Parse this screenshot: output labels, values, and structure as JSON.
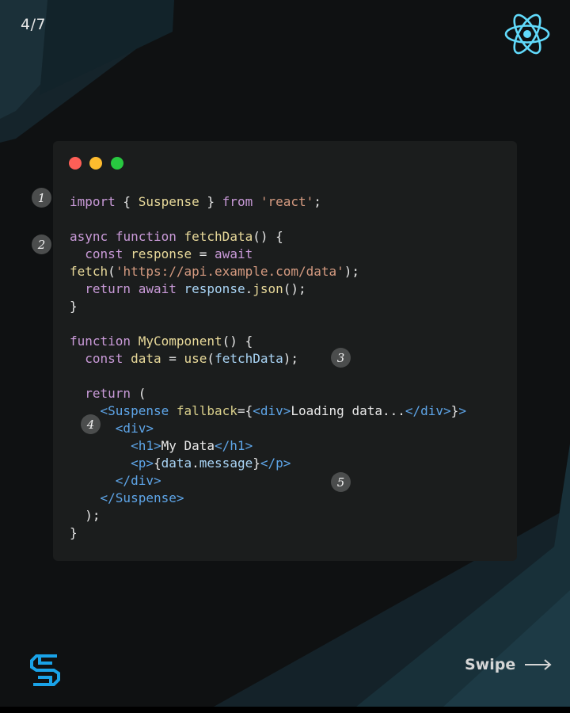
{
  "page_counter": "4/7",
  "colors": {
    "background": "#0f1112",
    "card": "#1b1d1d",
    "keyword": "#c99ad8",
    "function": "#e8d99a",
    "string": "#d49a80",
    "tag": "#5ea5e8",
    "attribute": "#d9cf8b",
    "variable": "#a9d4f5",
    "react_logo": "#61dafb",
    "brand_logo": "#1aa3e8"
  },
  "window_dots": [
    "red",
    "yellow",
    "green"
  ],
  "code_lines": [
    [
      [
        "keyword",
        "import"
      ],
      [
        "default",
        " { "
      ],
      [
        "func",
        "Suspense"
      ],
      [
        "default",
        " } "
      ],
      [
        "keyword",
        "from"
      ],
      [
        "default",
        " "
      ],
      [
        "string",
        "'react'"
      ],
      [
        "default",
        ";"
      ]
    ],
    [],
    [
      [
        "keyword",
        "async"
      ],
      [
        "default",
        " "
      ],
      [
        "keyword",
        "function"
      ],
      [
        "default",
        " "
      ],
      [
        "func",
        "fetchData"
      ],
      [
        "default",
        "() {"
      ]
    ],
    [
      [
        "default",
        "  "
      ],
      [
        "keyword",
        "const"
      ],
      [
        "default",
        " "
      ],
      [
        "func",
        "response"
      ],
      [
        "default",
        " = "
      ],
      [
        "keyword",
        "await"
      ]
    ],
    [
      [
        "func",
        "fetch"
      ],
      [
        "default",
        "("
      ],
      [
        "string",
        "'https://api.example.com/data'"
      ],
      [
        "default",
        ");"
      ]
    ],
    [
      [
        "default",
        "  "
      ],
      [
        "keyword",
        "return"
      ],
      [
        "default",
        " "
      ],
      [
        "keyword",
        "await"
      ],
      [
        "default",
        " "
      ],
      [
        "var",
        "response"
      ],
      [
        "default",
        "."
      ],
      [
        "func",
        "json"
      ],
      [
        "default",
        "();"
      ]
    ],
    [
      [
        "default",
        "}"
      ]
    ],
    [],
    [
      [
        "keyword",
        "function"
      ],
      [
        "default",
        " "
      ],
      [
        "func",
        "MyComponent"
      ],
      [
        "default",
        "() {"
      ]
    ],
    [
      [
        "default",
        "  "
      ],
      [
        "keyword",
        "const"
      ],
      [
        "default",
        " "
      ],
      [
        "func",
        "data"
      ],
      [
        "default",
        " = "
      ],
      [
        "func",
        "use"
      ],
      [
        "default",
        "("
      ],
      [
        "var",
        "fetchData"
      ],
      [
        "default",
        ");"
      ]
    ],
    [],
    [
      [
        "default",
        "  "
      ],
      [
        "keyword",
        "return"
      ],
      [
        "default",
        " ("
      ]
    ],
    [
      [
        "default",
        "    "
      ],
      [
        "tag",
        "<Suspense"
      ],
      [
        "default",
        " "
      ],
      [
        "attr",
        "fallback"
      ],
      [
        "default",
        "={"
      ],
      [
        "tag",
        "<div>"
      ],
      [
        "default",
        "Loading data..."
      ],
      [
        "tag",
        "</div>"
      ],
      [
        "default",
        "}"
      ],
      [
        "tag",
        ">"
      ]
    ],
    [
      [
        "default",
        "      "
      ],
      [
        "tag",
        "<div>"
      ]
    ],
    [
      [
        "default",
        "        "
      ],
      [
        "tag",
        "<h1>"
      ],
      [
        "default",
        "My Data"
      ],
      [
        "tag",
        "</h1>"
      ]
    ],
    [
      [
        "default",
        "        "
      ],
      [
        "tag",
        "<p>"
      ],
      [
        "default",
        "{"
      ],
      [
        "var",
        "data"
      ],
      [
        "default",
        "."
      ],
      [
        "var",
        "message"
      ],
      [
        "default",
        "}"
      ],
      [
        "tag",
        "</p>"
      ]
    ],
    [
      [
        "default",
        "      "
      ],
      [
        "tag",
        "</div>"
      ]
    ],
    [
      [
        "default",
        "    "
      ],
      [
        "tag",
        "</Suspense>"
      ]
    ],
    [
      [
        "default",
        "  );"
      ]
    ],
    [
      [
        "default",
        "}"
      ]
    ]
  ],
  "badges": [
    "1",
    "2",
    "3",
    "4",
    "5"
  ],
  "swipe_label": "Swipe",
  "icons": {
    "react": "react-logo-icon",
    "brand": "brand-logo-icon",
    "arrow": "arrow-right-icon"
  }
}
